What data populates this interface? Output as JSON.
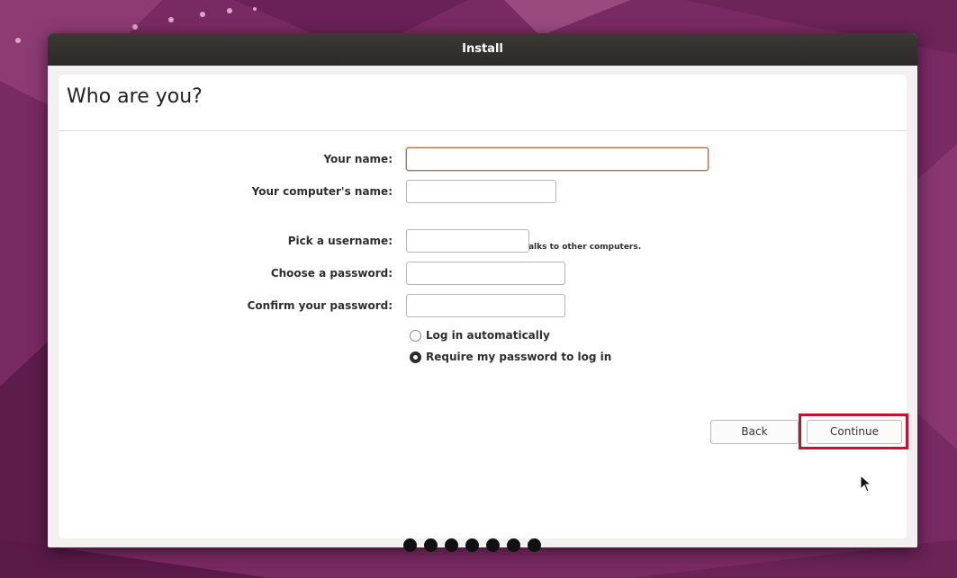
{
  "window": {
    "title": "Install"
  },
  "page": {
    "title": "Who are you?"
  },
  "form": {
    "your_name": {
      "label": "Your name:",
      "value": ""
    },
    "computer_name": {
      "label": "Your computer's name:",
      "value": "",
      "hint": "The name it uses when it talks to other computers."
    },
    "username": {
      "label": "Pick a username:",
      "value": ""
    },
    "password": {
      "label": "Choose a password:",
      "value": ""
    },
    "confirm_password": {
      "label": "Confirm your password:",
      "value": ""
    },
    "login_options": [
      {
        "label": "Log in automatically",
        "selected": false
      },
      {
        "label": "Require my password to log in",
        "selected": true
      }
    ]
  },
  "buttons": {
    "back": "Back",
    "continue": "Continue"
  },
  "progress": {
    "total_steps": 7
  },
  "colors": {
    "wallpaper": "#7a2a63",
    "highlight": "#c8102e",
    "focus_border": "#b06a44"
  }
}
